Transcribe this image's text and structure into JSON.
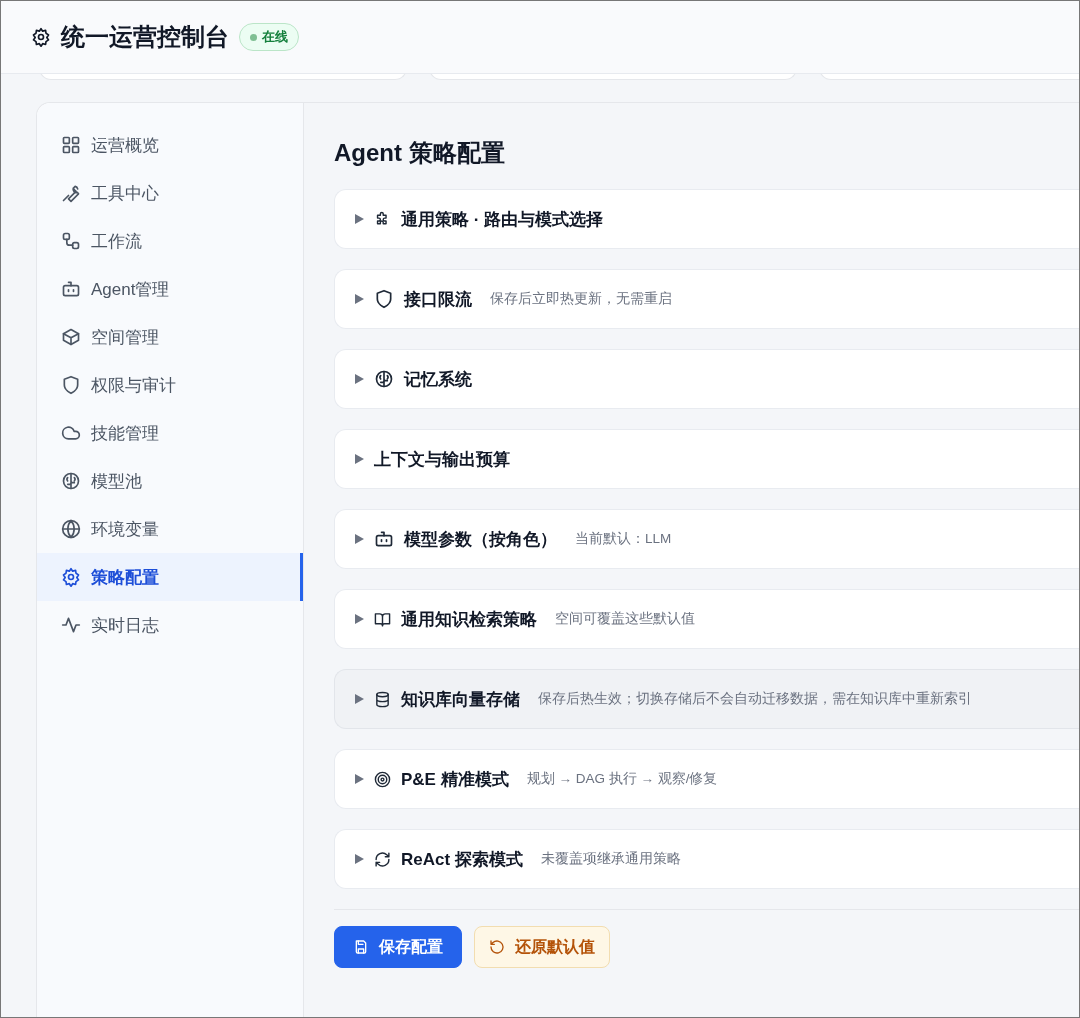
{
  "header": {
    "title": "统一运营控制台",
    "status": "在线"
  },
  "sidebar": {
    "items": [
      {
        "label": "运营概览",
        "selected": false
      },
      {
        "label": "工具中心",
        "selected": false
      },
      {
        "label": "工作流",
        "selected": false
      },
      {
        "label": "Agent管理",
        "selected": false
      },
      {
        "label": "空间管理",
        "selected": false
      },
      {
        "label": "权限与审计",
        "selected": false
      },
      {
        "label": "技能管理",
        "selected": false
      },
      {
        "label": "模型池",
        "selected": false
      },
      {
        "label": "环境变量",
        "selected": false
      },
      {
        "label": "策略配置",
        "selected": true
      },
      {
        "label": "实时日志",
        "selected": false
      }
    ]
  },
  "content": {
    "title": "Agent 策略配置",
    "sections": [
      {
        "title": "通用策略 · 路由与模式选择",
        "expanded": false,
        "hovered": false
      },
      {
        "title": "接口限流",
        "note": "保存后立即热更新，无需重启",
        "expanded": false,
        "hovered": false
      },
      {
        "title": "记忆系统",
        "expanded": false,
        "hovered": false
      },
      {
        "title": "上下文与输出预算",
        "expanded": false,
        "hovered": false
      },
      {
        "title": "模型参数（按角色）",
        "note": "当前默认：LLM",
        "expanded": false,
        "hovered": false
      },
      {
        "title": "通用知识检索策略",
        "note": "空间可覆盖这些默认值",
        "expanded": false,
        "hovered": false
      },
      {
        "title": "知识库向量存储",
        "note": "保存后热生效；切换存储后不会自动迁移数据，需在知识库中重新索引",
        "expanded": false,
        "hovered": true
      },
      {
        "title": "P&E 精准模式",
        "note": "规划 → DAG 执行 → 观察/修复",
        "expanded": false,
        "hovered": false
      },
      {
        "title": "ReAct 探索模式",
        "note": "未覆盖项继承通用策略",
        "expanded": false,
        "hovered": false
      }
    ],
    "buttons": [
      {
        "kind": "primary",
        "label": "保存配置"
      },
      {
        "kind": "secondary",
        "label": "还原默认值"
      }
    ]
  }
}
